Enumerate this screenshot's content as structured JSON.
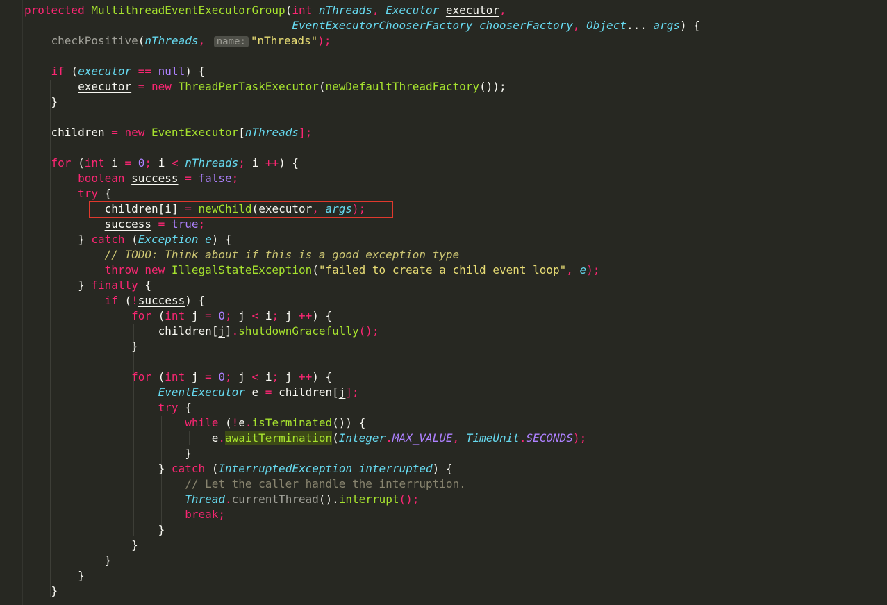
{
  "lines": [
    [
      {
        "t": "protected ",
        "c": "kw"
      },
      {
        "t": "MultithreadEventExecutorGroup",
        "c": "fn"
      },
      {
        "t": "(",
        "c": ""
      },
      {
        "t": "int ",
        "c": "kw"
      },
      {
        "t": "nThreads",
        "c": "par"
      },
      {
        "t": ", ",
        "c": "kw"
      },
      {
        "t": "Executor ",
        "c": "par"
      },
      {
        "t": "executor",
        "c": "ul"
      },
      {
        "t": ",",
        "c": "kw"
      }
    ],
    [
      {
        "t": "                                        ",
        "c": ""
      },
      {
        "t": "EventExecutorChooserFactory ",
        "c": "par"
      },
      {
        "t": "chooserFactory",
        "c": "par"
      },
      {
        "t": ", ",
        "c": "kw"
      },
      {
        "t": "Object",
        "c": "par"
      },
      {
        "t": "... ",
        "c": ""
      },
      {
        "t": "args",
        "c": "par"
      },
      {
        "t": ") {",
        "c": ""
      }
    ],
    [
      {
        "t": "    ",
        "c": ""
      },
      {
        "t": "checkPositive",
        "c": "gry"
      },
      {
        "t": "(",
        "c": ""
      },
      {
        "t": "nThreads",
        "c": "par"
      },
      {
        "t": ", ",
        "c": "kw"
      },
      {
        "t": "name:",
        "c": "hint"
      },
      {
        "t": "\"nThreads\"",
        "c": "str"
      },
      {
        "t": ");",
        "c": "kw"
      }
    ],
    [],
    [
      {
        "t": "    ",
        "c": ""
      },
      {
        "t": "if ",
        "c": "kw"
      },
      {
        "t": "(",
        "c": ""
      },
      {
        "t": "executor",
        "c": "par"
      },
      {
        "t": " == ",
        "c": "kw"
      },
      {
        "t": "null",
        "c": "num"
      },
      {
        "t": ") {",
        "c": ""
      }
    ],
    [
      {
        "t": "        ",
        "c": ""
      },
      {
        "t": "executor",
        "c": "ul"
      },
      {
        "t": " = ",
        "c": "kw"
      },
      {
        "t": "new ",
        "c": "kw"
      },
      {
        "t": "ThreadPerTaskExecutor",
        "c": "fn"
      },
      {
        "t": "(",
        "c": ""
      },
      {
        "t": "newDefaultThreadFactory",
        "c": "fn"
      },
      {
        "t": "());",
        "c": ""
      }
    ],
    [
      {
        "t": "    }",
        "c": ""
      }
    ],
    [],
    [
      {
        "t": "    children",
        "c": ""
      },
      {
        "t": " = ",
        "c": "kw"
      },
      {
        "t": "new ",
        "c": "kw"
      },
      {
        "t": "EventExecutor",
        "c": "fn"
      },
      {
        "t": "[",
        "c": ""
      },
      {
        "t": "nThreads",
        "c": "par"
      },
      {
        "t": "];",
        "c": "kw"
      }
    ],
    [],
    [
      {
        "t": "    ",
        "c": ""
      },
      {
        "t": "for ",
        "c": "kw"
      },
      {
        "t": "(",
        "c": ""
      },
      {
        "t": "int ",
        "c": "kw"
      },
      {
        "t": "i",
        "c": "ul"
      },
      {
        "t": " = ",
        "c": "kw"
      },
      {
        "t": "0",
        "c": "num"
      },
      {
        "t": "; ",
        "c": "kw"
      },
      {
        "t": "i",
        "c": "ul"
      },
      {
        "t": " < ",
        "c": "kw"
      },
      {
        "t": "nThreads",
        "c": "par"
      },
      {
        "t": "; ",
        "c": "kw"
      },
      {
        "t": "i",
        "c": "ul"
      },
      {
        "t": " ++",
        "c": "kw"
      },
      {
        "t": ") {",
        "c": ""
      }
    ],
    [
      {
        "t": "        ",
        "c": ""
      },
      {
        "t": "boolean ",
        "c": "kw"
      },
      {
        "t": "success",
        "c": "ul"
      },
      {
        "t": " = ",
        "c": "kw"
      },
      {
        "t": "false",
        "c": "num"
      },
      {
        "t": ";",
        "c": "kw"
      }
    ],
    [
      {
        "t": "        ",
        "c": ""
      },
      {
        "t": "try ",
        "c": "kw"
      },
      {
        "t": "{",
        "c": ""
      }
    ],
    [
      {
        "t": "            children[",
        "c": ""
      },
      {
        "t": "i",
        "c": "ul"
      },
      {
        "t": "]",
        "c": ""
      },
      {
        "t": " = ",
        "c": "kw"
      },
      {
        "t": "newChild",
        "c": "fn"
      },
      {
        "t": "(",
        "c": ""
      },
      {
        "t": "executor",
        "c": "ul"
      },
      {
        "t": ", ",
        "c": "kw"
      },
      {
        "t": "args",
        "c": "par"
      },
      {
        "t": ");",
        "c": "kw"
      }
    ],
    [
      {
        "t": "            ",
        "c": ""
      },
      {
        "t": "success",
        "c": "ul"
      },
      {
        "t": " = ",
        "c": "kw"
      },
      {
        "t": "true",
        "c": "num"
      },
      {
        "t": ";",
        "c": "kw"
      }
    ],
    [
      {
        "t": "        } ",
        "c": ""
      },
      {
        "t": "catch ",
        "c": "kw"
      },
      {
        "t": "(",
        "c": ""
      },
      {
        "t": "Exception ",
        "c": "par"
      },
      {
        "t": "e",
        "c": "par"
      },
      {
        "t": ") {",
        "c": ""
      }
    ],
    [
      {
        "t": "            ",
        "c": ""
      },
      {
        "t": "// TODO: Think about if this is a good exception type",
        "c": "td"
      }
    ],
    [
      {
        "t": "            ",
        "c": ""
      },
      {
        "t": "throw ",
        "c": "kw"
      },
      {
        "t": "new ",
        "c": "kw"
      },
      {
        "t": "IllegalStateException",
        "c": "fn"
      },
      {
        "t": "(",
        "c": ""
      },
      {
        "t": "\"failed to create a child event loop\"",
        "c": "str"
      },
      {
        "t": ", ",
        "c": "kw"
      },
      {
        "t": "e",
        "c": "par"
      },
      {
        "t": ");",
        "c": "kw"
      }
    ],
    [
      {
        "t": "        } ",
        "c": ""
      },
      {
        "t": "finally ",
        "c": "kw"
      },
      {
        "t": "{",
        "c": ""
      }
    ],
    [
      {
        "t": "            ",
        "c": ""
      },
      {
        "t": "if ",
        "c": "kw"
      },
      {
        "t": "(",
        "c": ""
      },
      {
        "t": "!",
        "c": "kw"
      },
      {
        "t": "success",
        "c": "ul"
      },
      {
        "t": ") {",
        "c": ""
      }
    ],
    [
      {
        "t": "                ",
        "c": ""
      },
      {
        "t": "for ",
        "c": "kw"
      },
      {
        "t": "(",
        "c": ""
      },
      {
        "t": "int ",
        "c": "kw"
      },
      {
        "t": "j",
        "c": "ul"
      },
      {
        "t": " = ",
        "c": "kw"
      },
      {
        "t": "0",
        "c": "num"
      },
      {
        "t": "; ",
        "c": "kw"
      },
      {
        "t": "j",
        "c": "ul"
      },
      {
        "t": " < ",
        "c": "kw"
      },
      {
        "t": "i",
        "c": "ul"
      },
      {
        "t": "; ",
        "c": "kw"
      },
      {
        "t": "j",
        "c": "ul"
      },
      {
        "t": " ++",
        "c": "kw"
      },
      {
        "t": ") {",
        "c": ""
      }
    ],
    [
      {
        "t": "                    children[",
        "c": ""
      },
      {
        "t": "j",
        "c": "ul"
      },
      {
        "t": "]",
        "c": ""
      },
      {
        "t": ".",
        "c": "kw"
      },
      {
        "t": "shutdownGracefully",
        "c": "fn"
      },
      {
        "t": "();",
        "c": "kw"
      }
    ],
    [
      {
        "t": "                }",
        "c": ""
      }
    ],
    [],
    [
      {
        "t": "                ",
        "c": ""
      },
      {
        "t": "for ",
        "c": "kw"
      },
      {
        "t": "(",
        "c": ""
      },
      {
        "t": "int ",
        "c": "kw"
      },
      {
        "t": "j",
        "c": "ul"
      },
      {
        "t": " = ",
        "c": "kw"
      },
      {
        "t": "0",
        "c": "num"
      },
      {
        "t": "; ",
        "c": "kw"
      },
      {
        "t": "j",
        "c": "ul"
      },
      {
        "t": " < ",
        "c": "kw"
      },
      {
        "t": "i",
        "c": "ul"
      },
      {
        "t": "; ",
        "c": "kw"
      },
      {
        "t": "j",
        "c": "ul"
      },
      {
        "t": " ++",
        "c": "kw"
      },
      {
        "t": ") {",
        "c": ""
      }
    ],
    [
      {
        "t": "                    ",
        "c": ""
      },
      {
        "t": "EventExecutor ",
        "c": "par"
      },
      {
        "t": "e",
        "c": ""
      },
      {
        "t": " = ",
        "c": "kw"
      },
      {
        "t": "children[",
        "c": ""
      },
      {
        "t": "j",
        "c": "ul"
      },
      {
        "t": "];",
        "c": "kw"
      }
    ],
    [
      {
        "t": "                    ",
        "c": ""
      },
      {
        "t": "try ",
        "c": "kw"
      },
      {
        "t": "{",
        "c": ""
      }
    ],
    [
      {
        "t": "                        ",
        "c": ""
      },
      {
        "t": "while ",
        "c": "kw"
      },
      {
        "t": "(",
        "c": ""
      },
      {
        "t": "!",
        "c": "kw"
      },
      {
        "t": "e",
        "c": ""
      },
      {
        "t": ".",
        "c": "kw"
      },
      {
        "t": "isTerminated",
        "c": "fn"
      },
      {
        "t": "()) {",
        "c": ""
      }
    ],
    [
      {
        "t": "                            e",
        "c": ""
      },
      {
        "t": ".",
        "c": "kw"
      },
      {
        "t": "awaitTermination",
        "c": "fn hl"
      },
      {
        "t": "(",
        "c": ""
      },
      {
        "t": "Integer",
        "c": "par"
      },
      {
        "t": ".",
        "c": "kw"
      },
      {
        "t": "MAX_VALUE",
        "c": "cst"
      },
      {
        "t": ", ",
        "c": "kw"
      },
      {
        "t": "TimeUnit",
        "c": "par"
      },
      {
        "t": ".",
        "c": "kw"
      },
      {
        "t": "SECONDS",
        "c": "cst"
      },
      {
        "t": ");",
        "c": "kw"
      }
    ],
    [
      {
        "t": "                        }",
        "c": ""
      }
    ],
    [
      {
        "t": "                    } ",
        "c": ""
      },
      {
        "t": "catch ",
        "c": "kw"
      },
      {
        "t": "(",
        "c": ""
      },
      {
        "t": "InterruptedException ",
        "c": "par"
      },
      {
        "t": "interrupted",
        "c": "par"
      },
      {
        "t": ") {",
        "c": ""
      }
    ],
    [
      {
        "t": "                        ",
        "c": ""
      },
      {
        "t": "// Let the caller handle the interruption.",
        "c": "dim"
      }
    ],
    [
      {
        "t": "                        ",
        "c": ""
      },
      {
        "t": "Thread",
        "c": "par"
      },
      {
        "t": ".",
        "c": "kw"
      },
      {
        "t": "currentThread",
        "c": "gry"
      },
      {
        "t": "().",
        "c": ""
      },
      {
        "t": "interrupt",
        "c": "fn"
      },
      {
        "t": "();",
        "c": "kw"
      }
    ],
    [
      {
        "t": "                        ",
        "c": ""
      },
      {
        "t": "break",
        "c": "kw"
      },
      {
        "t": ";",
        "c": "kw"
      }
    ],
    [
      {
        "t": "                    }",
        "c": ""
      }
    ],
    [
      {
        "t": "                }",
        "c": ""
      }
    ],
    [
      {
        "t": "            }",
        "c": ""
      }
    ],
    [
      {
        "t": "        }",
        "c": ""
      }
    ],
    [
      {
        "t": "    }",
        "c": ""
      }
    ]
  ],
  "highlight_box_line": 13
}
